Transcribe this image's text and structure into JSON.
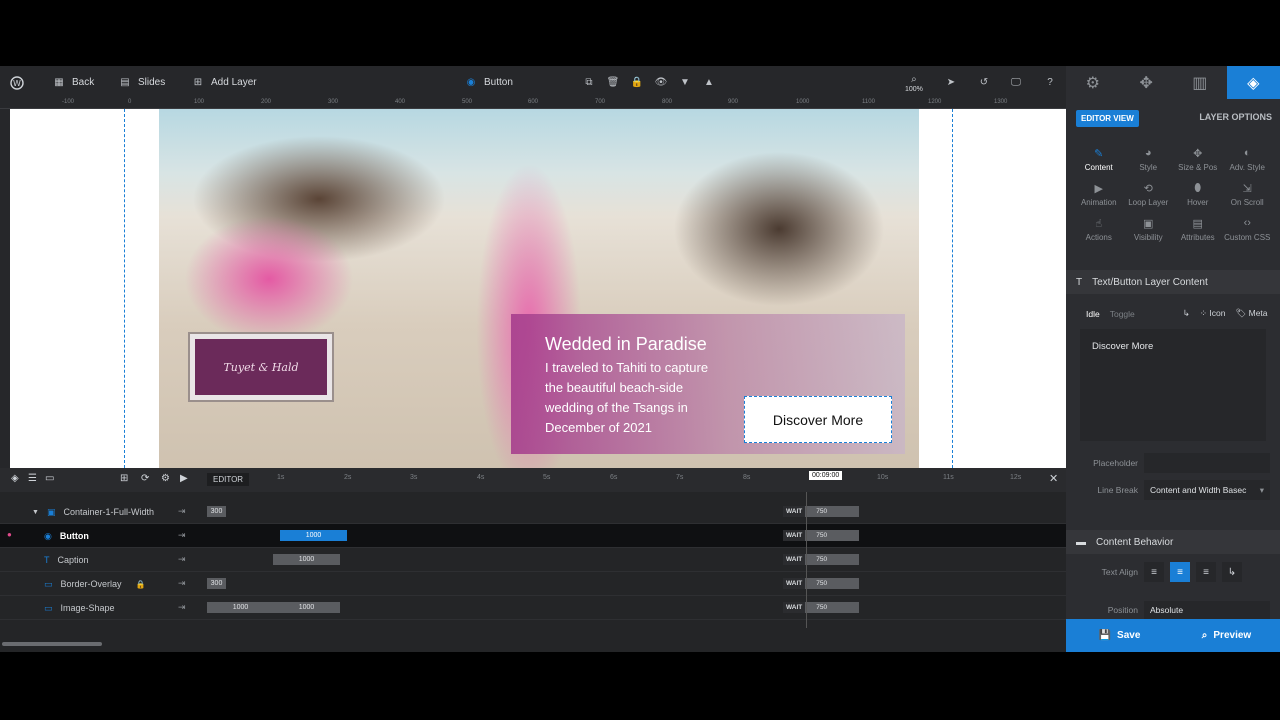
{
  "toolbar": {
    "back": "Back",
    "slides": "Slides",
    "add_layer": "Add Layer",
    "current_layer": "Button",
    "zoom": "100%"
  },
  "ruler": [
    "-100",
    "0",
    "100",
    "200",
    "300",
    "400",
    "500",
    "600",
    "700",
    "800",
    "900",
    "1000",
    "1100",
    "1200",
    "1300"
  ],
  "slide": {
    "sign_text": "Tuyet & Hald",
    "card_title": "Wedded in Paradise",
    "card_body": "I traveled to Tahiti to capture the beautiful beach-side wedding of the Tsangs in December of 2021",
    "button_label": "Discover More"
  },
  "panel": {
    "editor_view": "EDITOR VIEW",
    "layer_options": "LAYER OPTIONS",
    "options": [
      {
        "label": "Content",
        "icon": "pencil-icon"
      },
      {
        "label": "Style",
        "icon": "palette-icon"
      },
      {
        "label": "Size & Pos",
        "icon": "move-icon"
      },
      {
        "label": "Adv. Style",
        "icon": "drop-icon"
      },
      {
        "label": "Animation",
        "icon": "play-icon"
      },
      {
        "label": "Loop Layer",
        "icon": "loop-icon"
      },
      {
        "label": "Hover",
        "icon": "mouse-icon"
      },
      {
        "label": "On Scroll",
        "icon": "scroll-icon"
      },
      {
        "label": "Actions",
        "icon": "hand-icon"
      },
      {
        "label": "Visibility",
        "icon": "eye-icon"
      },
      {
        "label": "Attributes",
        "icon": "file-icon"
      },
      {
        "label": "Custom CSS",
        "icon": "code-icon"
      }
    ],
    "section_text": "Text/Button Layer Content",
    "idle": "Idle",
    "toggle": "Toggle",
    "icon_btn": "Icon",
    "meta_btn": "Meta",
    "content_value": "Discover More",
    "placeholder_label": "Placeholder",
    "line_break_label": "Line Break",
    "line_break_value": "Content and Width Basec",
    "section_behavior": "Content Behavior",
    "text_align_label": "Text Align",
    "position_label": "Position",
    "position_value": "Absolute",
    "save": "Save",
    "preview": "Preview"
  },
  "timeline": {
    "editor_label": "EDITOR",
    "ticks": [
      "1s",
      "2s",
      "3s",
      "4s",
      "5s",
      "6s",
      "7s",
      "8s",
      "9s",
      "10s",
      "11s",
      "12s"
    ],
    "current_time": "00:09:00",
    "layers": [
      {
        "name": "Container-1-Full-Width",
        "bars": [
          {
            "label": "300"
          }
        ],
        "wait": "WAIT",
        "end": "750"
      },
      {
        "name": "Button",
        "bars": [
          {
            "label": "1000"
          }
        ],
        "wait": "WAIT",
        "end": "750"
      },
      {
        "name": "Caption",
        "bars": [
          {
            "label": "1000"
          }
        ],
        "wait": "WAIT",
        "end": "750"
      },
      {
        "name": "Border-Overlay",
        "bars": [
          {
            "label": "300"
          }
        ],
        "wait": "WAIT",
        "end": "750"
      },
      {
        "name": "Image-Shape",
        "bars": [
          {
            "label": "1000"
          },
          {
            "label": "1000"
          }
        ],
        "wait": "WAIT",
        "end": "750"
      }
    ]
  },
  "colors": {
    "accent": "#1a7fd6",
    "background": "#2c2d31"
  }
}
